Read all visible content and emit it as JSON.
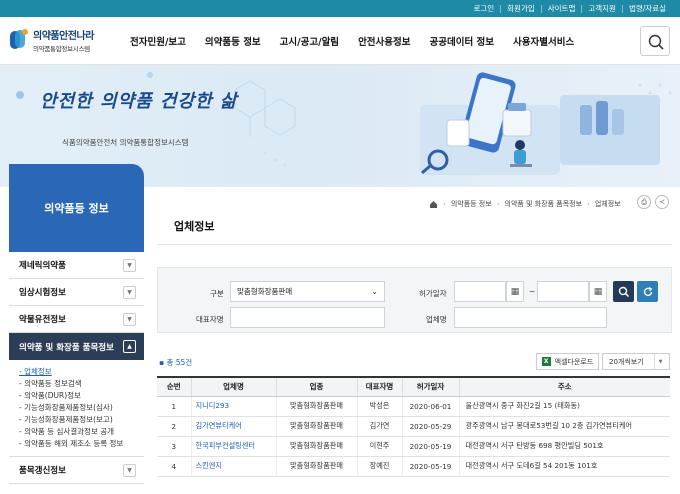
{
  "top_links": [
    "로그인",
    "회원가입",
    "사이트맵",
    "고객지원",
    "법령/자료실"
  ],
  "logo": {
    "title": "의약품안전나라",
    "subtitle": "의약품통합정보시스템"
  },
  "gnb": [
    "전자민원/보고",
    "의약품등 정보",
    "고시/공고/알림",
    "안전사용정보",
    "공공데이터 정보",
    "사용자별서비스"
  ],
  "banner": {
    "slogan": "안전한 의약품 건강한 삶",
    "subtitle": "식품의약품안전처 의약품통합정보시스템"
  },
  "sidebar": {
    "heading": "의약품등 정보",
    "items": [
      {
        "label": "제네릭의약품"
      },
      {
        "label": "임상시험정보"
      },
      {
        "label": "약물유전정보"
      },
      {
        "label": "의약품 및 화장품 품목정보",
        "active": true
      }
    ],
    "sub_items": [
      "업체정보",
      "의약품등 정보검색",
      "의약품(DUR)정보",
      "기능성화장품제품정보(심사)",
      "기능성화장품제품정보(보고)",
      "의약품 등 심사결과정보 공개",
      "의약품등 해외 제조소 등록 정보"
    ],
    "active_sub": "업체정보",
    "last_item": "품목갱신정보"
  },
  "breadcrumb": [
    "의약품등 정보",
    "의약품 및 화장품 품목정보",
    "업체정보"
  ],
  "page_title": "업체정보",
  "search": {
    "type_label": "구분",
    "type_value": "맞춤형화장품판매",
    "permit_label": "허가일자",
    "permit_sep": "~",
    "rep_label": "대표자명",
    "company_label": "업체명"
  },
  "result": {
    "total": "총 55건",
    "excel_label": "엑셀다운로드",
    "per_page": "20개씩보기"
  },
  "table": {
    "headers": [
      "순번",
      "업체명",
      "업종",
      "대표자명",
      "허가일자",
      "주소"
    ],
    "rows": [
      {
        "no": "1",
        "name": "지니디293",
        "type": "맞춤형화장품판매",
        "rep": "박성은",
        "date": "2020-06-01",
        "addr": "울산광역시 중구 화진2길 15 (태화동)"
      },
      {
        "no": "2",
        "name": "김가연뷰티케어",
        "type": "맞춤형화장품판매",
        "rep": "김가연",
        "date": "2020-05-29",
        "addr": "광주광역시 남구 봉대로53번길 10 2층 김가연뷰티케어"
      },
      {
        "no": "3",
        "name": "한국피부컨설팅센터",
        "type": "맞춤형화장품판매",
        "rep": "이현주",
        "date": "2020-05-19",
        "addr": "대전광역시 서구 탄방동 698 평안빌딩 501호"
      },
      {
        "no": "4",
        "name": "스킨엔지",
        "type": "맞춤형화장품판매",
        "rep": "장예진",
        "date": "2020-05-19",
        "addr": "대전광역시 서구 도데6길 54 201동 101호"
      }
    ]
  }
}
